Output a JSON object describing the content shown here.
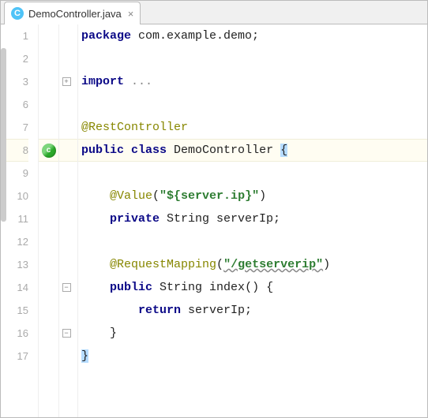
{
  "tab": {
    "icon_letter": "C",
    "title": "DemoController.java",
    "close": "×"
  },
  "lines": {
    "n1": "1",
    "n2": "2",
    "n3": "3",
    "n6": "6",
    "n7": "7",
    "n8": "8",
    "n9": "9",
    "n10": "10",
    "n11": "11",
    "n12": "12",
    "n13": "13",
    "n14": "14",
    "n15": "15",
    "n16": "16",
    "n17": "17"
  },
  "fold": {
    "plus": "+",
    "minus": "−"
  },
  "marker": {
    "spring": "c"
  },
  "code": {
    "l1_kw": "package",
    "l1_rest": " com.example.demo;",
    "l3_kw": "import",
    "l3_rest": " ...",
    "l7_ann": "@RestController",
    "l8_kw1": "public",
    "l8_kw2": "class",
    "l8_id": " DemoController ",
    "l8_brace": "{",
    "l10_ann": "@Value",
    "l10_paren_l": "(",
    "l10_str": "\"${server.ip}\"",
    "l10_paren_r": ")",
    "l11_kw": "private",
    "l11_type": " String ",
    "l11_var": "serverIp;",
    "l13_ann": "@RequestMapping",
    "l13_paren_l": "(",
    "l13_str": "\"/getserverip\"",
    "l13_paren_r": ")",
    "l14_kw": "public",
    "l14_type": " String ",
    "l14_method": "index",
    "l14_rest": "() {",
    "l15_kw": "return",
    "l15_rest": " serverIp;",
    "l16_brace": "}",
    "l17_brace": "}"
  }
}
